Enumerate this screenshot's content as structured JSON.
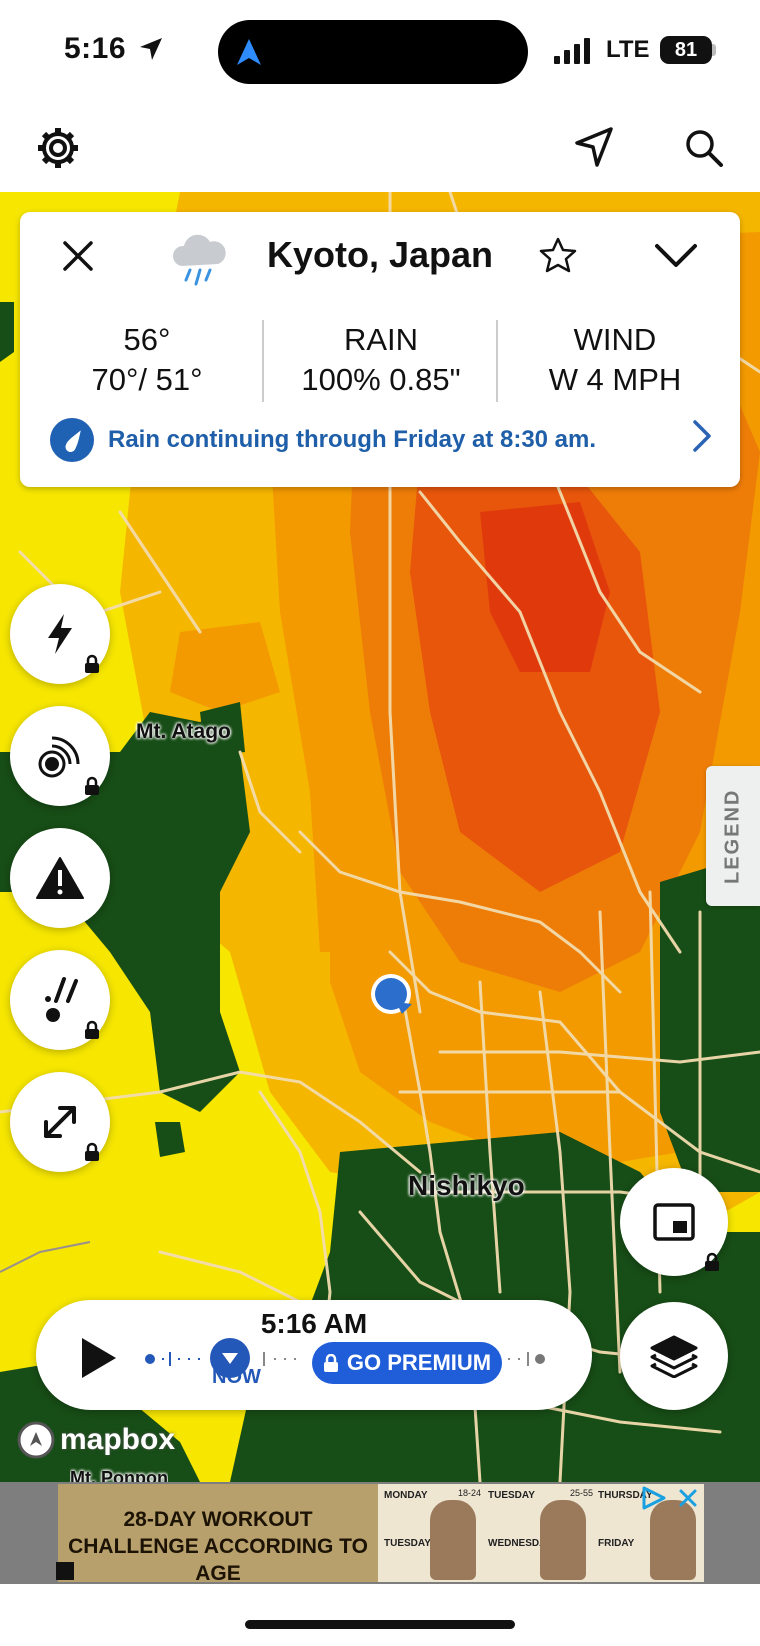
{
  "status_bar": {
    "time": "5:16",
    "network": "LTE",
    "battery": "81"
  },
  "location_card": {
    "city": "Kyoto, Japan",
    "temperature": {
      "current": "56°",
      "range": "70°/ 51°"
    },
    "rain": {
      "label": "RAIN",
      "value": "100% 0.85\""
    },
    "wind": {
      "label": "WIND",
      "value": "W 4 MPH"
    },
    "alert": "Rain continuing through Friday at 8:30 am."
  },
  "map": {
    "labels": {
      "mt_atago": "Mt. Atago",
      "nishikyo": "Nishikyo",
      "mt_ponpon": "Mt. Ponpon"
    },
    "legend_label": "LEGEND",
    "attribution": "mapbox",
    "colors": {
      "yellow": "#f6e600",
      "orange": "#f29a00",
      "red": "#e03a0c",
      "green": "#174d16"
    }
  },
  "timeline": {
    "time": "5:16 AM",
    "now_label": "NOW",
    "premium_label": "GO PREMIUM"
  },
  "ad": {
    "headline": "28-DAY WORKOUT CHALLENGE ACCORDING TO AGE",
    "days": [
      "MONDAY",
      "TUESDAY",
      "WEDNESDAY",
      "THURSDAY",
      "FRIDAY",
      "TUESDAY"
    ],
    "ages": [
      "18-24",
      "25-55"
    ]
  },
  "icons": [
    "gear-icon",
    "navigation-arrow-icon",
    "search-icon",
    "close-icon",
    "rain-cloud-icon",
    "star-icon",
    "chevron-down-icon",
    "lightning-icon",
    "radar-icon",
    "warning-icon",
    "hail-icon",
    "expand-icon",
    "lock-icon",
    "picture-in-picture-icon",
    "layers-icon",
    "play-icon"
  ]
}
